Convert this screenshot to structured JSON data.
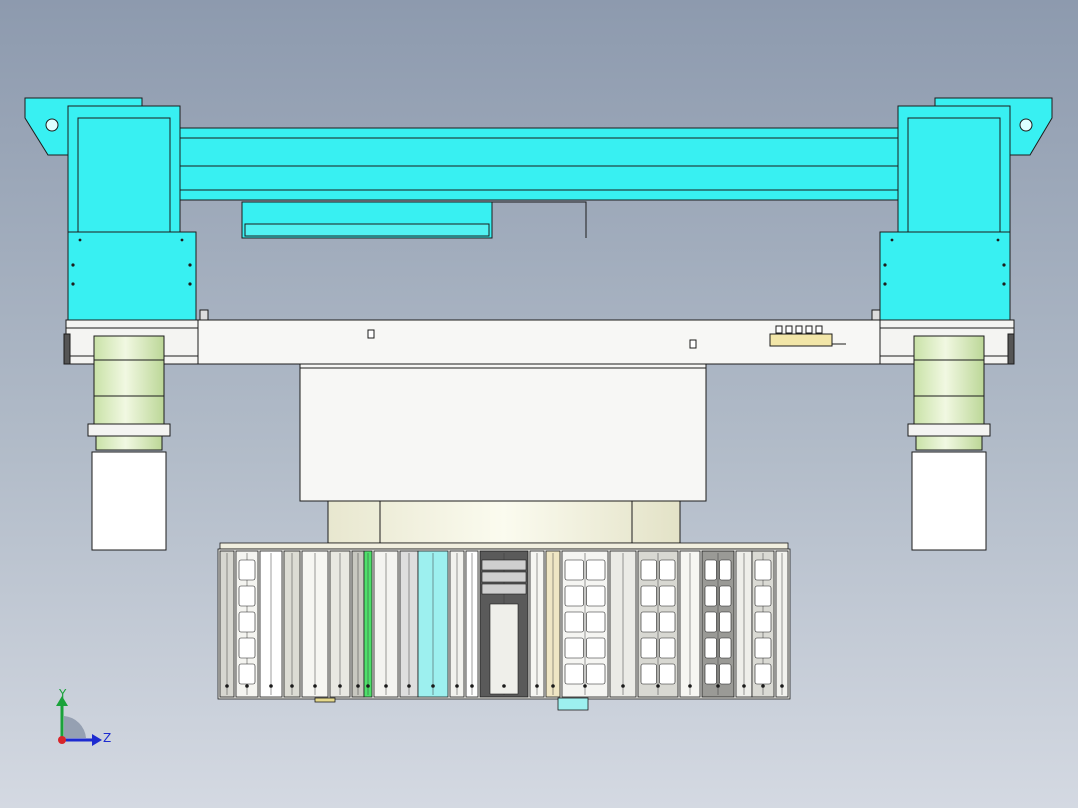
{
  "viewport": {
    "background_top": "#8d9aae",
    "background_bottom": "#d4d9e2"
  },
  "model": {
    "colors": {
      "frame": "#38f0f2",
      "frame_dark": "#15c7cb",
      "outline": "#1c1c1c",
      "housing": "#f4f4f2",
      "cylinder": "#e6f3cf",
      "motor": "#ffffff",
      "carousel": "#e9e9e4",
      "carousel_dark": "#5a5a5a",
      "accent_green": "#4ee06a",
      "accent_cyan": "#9df0ef",
      "accent_cream": "#efe6c4"
    },
    "parts": [
      "gantry-frame",
      "crossbeam",
      "left-column",
      "right-column",
      "plate-beam",
      "center-housing",
      "tool-carousel",
      "left-actuator",
      "right-actuator"
    ]
  },
  "triad": {
    "y_label": "Y",
    "z_label": "Z",
    "colors": {
      "y": "#1aa23a",
      "z": "#1d2bd0",
      "origin": "#d8262b"
    }
  }
}
